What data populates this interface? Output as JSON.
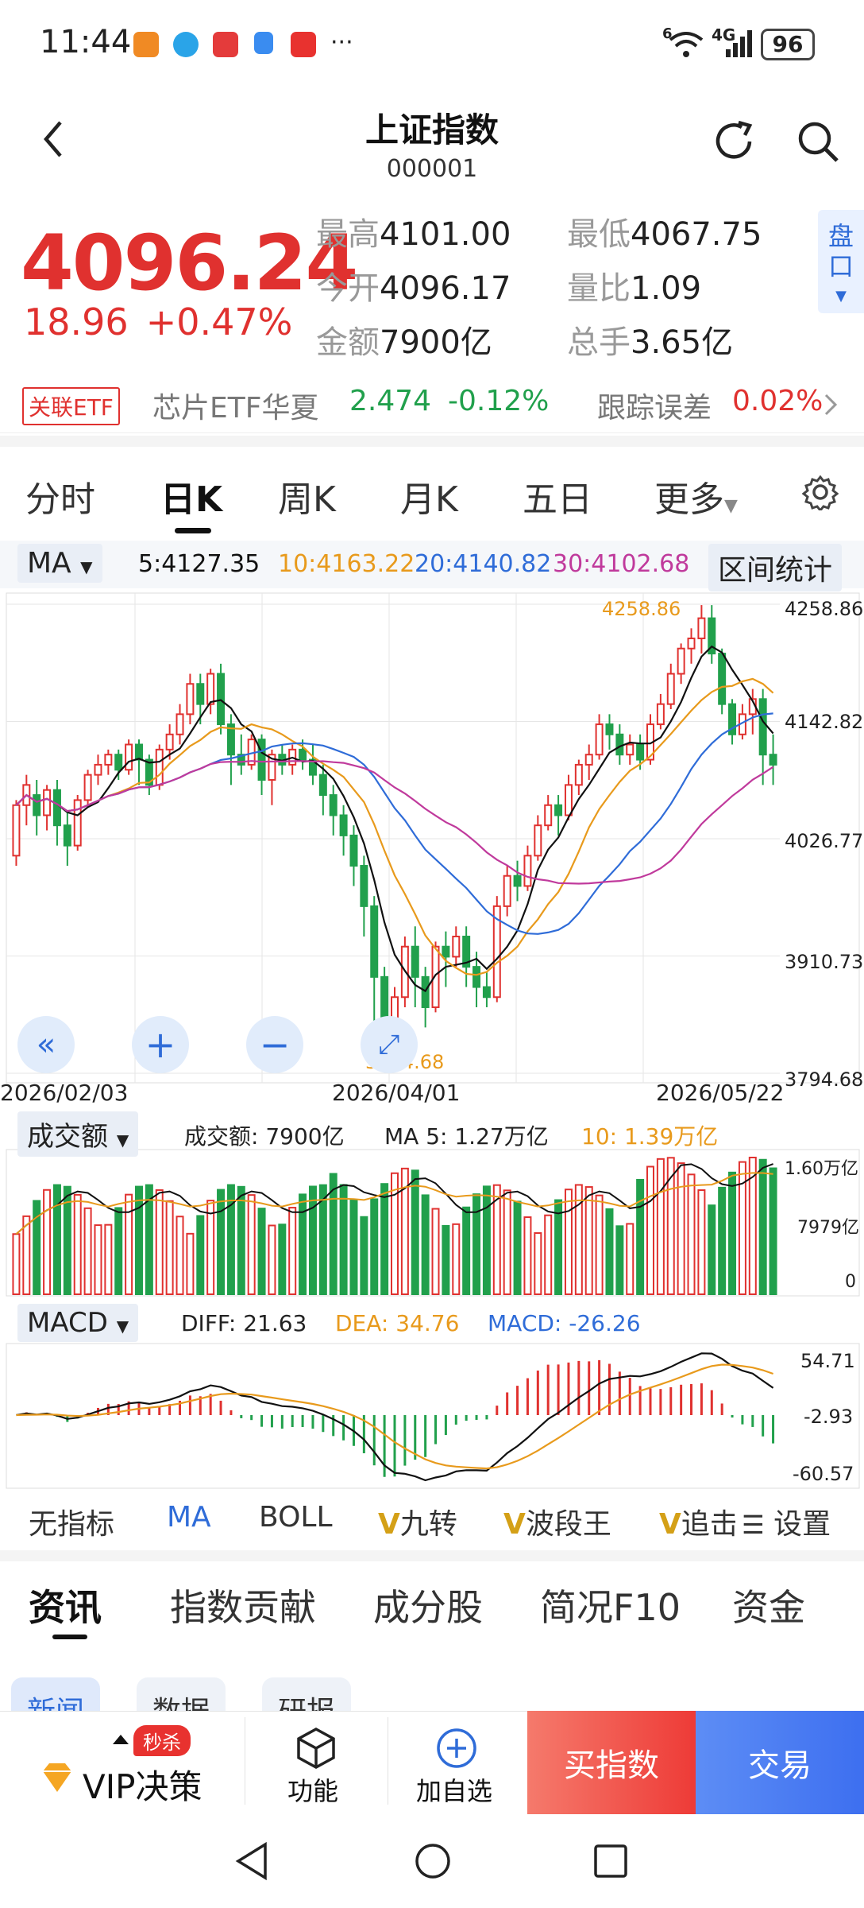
{
  "status_bar": {
    "time": "11:44",
    "network": "4G",
    "battery": "96",
    "more": "···",
    "wifi_sub": "6"
  },
  "header": {
    "title": "上证指数",
    "code": "000001"
  },
  "quote": {
    "price": "4096.24",
    "change": "18.96",
    "change_pct": "+0.47%",
    "high_label": "最高",
    "high": "4101.00",
    "low_label": "最低",
    "low": "4067.75",
    "open_label": "今开",
    "open": "4096.17",
    "vol_ratio_label": "量比",
    "vol_ratio": "1.09",
    "amount_label": "金额",
    "amount": "7900亿",
    "turnover_label": "总手",
    "turnover": "3.65亿",
    "pankou": "盘口"
  },
  "etf": {
    "tag": "关联ETF",
    "name": "芯片ETF华夏",
    "price": "2.474",
    "pct": "-0.12%",
    "err_label": "跟踪误差",
    "err": "0.02%"
  },
  "period_tabs": [
    "分时",
    "日K",
    "周K",
    "月K",
    "五日",
    "更多"
  ],
  "ma_bar": {
    "select": "MA",
    "ma5": "5:4127.35",
    "ma10": "10:4163.22",
    "ma20": "20:4140.82",
    "ma30": "30:4102.68",
    "range_btn": "区间统计"
  },
  "kline": {
    "price_ticks": [
      "4258.86",
      "4142.82",
      "4026.77",
      "3910.73",
      "3794.68"
    ],
    "date_labels": [
      "2026/02/03",
      "2026/04/01",
      "2026/05/22"
    ],
    "max_label": "4258.86",
    "min_label": "3794.68"
  },
  "volume": {
    "select": "成交额",
    "amount_text": "成交额: 7900亿",
    "ma5_text": "MA 5: 1.27万亿",
    "ma10_text": "10: 1.39万亿",
    "ticks": [
      "1.60万亿",
      "7979亿",
      "0"
    ]
  },
  "macd": {
    "select": "MACD",
    "diff": "DIFF: 21.63",
    "dea": "DEA: 34.76",
    "macd": "MACD: -26.26",
    "ticks": [
      "54.71",
      "-2.93",
      "-60.57"
    ]
  },
  "indicator_tabs": [
    "无指标",
    "MA",
    "BOLL",
    "九转",
    "波段王",
    "追击"
  ],
  "indicator_vip_prefix": "V",
  "settings_label": "设置",
  "info_tabs": [
    "资讯",
    "指数贡献",
    "成分股",
    "简况F10",
    "资金"
  ],
  "sub_tabs": [
    "新闻",
    "数据",
    "研报"
  ],
  "footer": {
    "vip": "VIP决策",
    "vip_badge": "秒杀",
    "func": "功能",
    "add": "加自选",
    "buy": "买指数",
    "trade": "交易"
  },
  "colors": {
    "up": "#e0312f",
    "down": "#21a04c",
    "ma5": "#111111",
    "ma10": "#e89a1c",
    "ma20": "#2f6cd8",
    "ma30": "#c03a9c",
    "accent": "#2f6cd8"
  },
  "chart_data": {
    "type": "candlestick",
    "y_range": [
      3794.68,
      4258.86
    ],
    "candles": [
      [
        4010,
        4060,
        4000,
        4065
      ],
      [
        4060,
        4080,
        4040,
        4090
      ],
      [
        4070,
        4050,
        4030,
        4085
      ],
      [
        4050,
        4075,
        4035,
        4080
      ],
      [
        4075,
        4040,
        4020,
        4085
      ],
      [
        4040,
        4020,
        4000,
        4055
      ],
      [
        4020,
        4065,
        4015,
        4070
      ],
      [
        4065,
        4090,
        4060,
        4095
      ],
      [
        4090,
        4100,
        4080,
        4110
      ],
      [
        4100,
        4110,
        4090,
        4115
      ],
      [
        4110,
        4095,
        4085,
        4115
      ],
      [
        4095,
        4120,
        4090,
        4125
      ],
      [
        4120,
        4105,
        4080,
        4125
      ],
      [
        4105,
        4080,
        4070,
        4110
      ],
      [
        4080,
        4115,
        4075,
        4120
      ],
      [
        4115,
        4130,
        4105,
        4140
      ],
      [
        4130,
        4150,
        4120,
        4160
      ],
      [
        4150,
        4180,
        4140,
        4190
      ],
      [
        4180,
        4160,
        4140,
        4190
      ],
      [
        4160,
        4190,
        4150,
        4195
      ],
      [
        4190,
        4140,
        4130,
        4200
      ],
      [
        4140,
        4110,
        4080,
        4150
      ],
      [
        4110,
        4100,
        4090,
        4130
      ],
      [
        4100,
        4125,
        4095,
        4130
      ],
      [
        4125,
        4085,
        4070,
        4130
      ],
      [
        4085,
        4110,
        4060,
        4115
      ],
      [
        4110,
        4100,
        4090,
        4120
      ],
      [
        4100,
        4115,
        4090,
        4120
      ],
      [
        4115,
        4105,
        4095,
        4125
      ],
      [
        4105,
        4090,
        4080,
        4120
      ],
      [
        4090,
        4070,
        4050,
        4100
      ],
      [
        4070,
        4050,
        4030,
        4080
      ],
      [
        4050,
        4030,
        4010,
        4060
      ],
      [
        4030,
        4000,
        3980,
        4040
      ],
      [
        4000,
        3960,
        3930,
        4010
      ],
      [
        3960,
        3890,
        3800,
        3970
      ],
      [
        3890,
        3840,
        3800,
        3900
      ],
      [
        3840,
        3870,
        3810,
        3880
      ],
      [
        3870,
        3920,
        3860,
        3930
      ],
      [
        3920,
        3890,
        3860,
        3940
      ],
      [
        3890,
        3860,
        3840,
        3900
      ],
      [
        3860,
        3920,
        3855,
        3925
      ],
      [
        3920,
        3910,
        3880,
        3935
      ],
      [
        3910,
        3930,
        3900,
        3940
      ],
      [
        3930,
        3900,
        3880,
        3940
      ],
      [
        3900,
        3880,
        3860,
        3915
      ],
      [
        3880,
        3870,
        3860,
        3895
      ],
      [
        3870,
        3960,
        3865,
        3970
      ],
      [
        3960,
        3990,
        3950,
        4000
      ],
      [
        3990,
        3980,
        3965,
        4005
      ],
      [
        3980,
        4010,
        3975,
        4020
      ],
      [
        4010,
        4040,
        4005,
        4050
      ],
      [
        4040,
        4060,
        4035,
        4070
      ],
      [
        4060,
        4050,
        4030,
        4070
      ],
      [
        4050,
        4080,
        4045,
        4090
      ],
      [
        4080,
        4100,
        4070,
        4105
      ],
      [
        4100,
        4110,
        4085,
        4120
      ],
      [
        4110,
        4140,
        4105,
        4150
      ],
      [
        4140,
        4130,
        4115,
        4150
      ],
      [
        4130,
        4110,
        4100,
        4140
      ],
      [
        4110,
        4120,
        4100,
        4130
      ],
      [
        4120,
        4105,
        4095,
        4130
      ],
      [
        4105,
        4140,
        4100,
        4150
      ],
      [
        4140,
        4160,
        4135,
        4170
      ],
      [
        4160,
        4190,
        4155,
        4200
      ],
      [
        4190,
        4215,
        4180,
        4220
      ],
      [
        4215,
        4225,
        4200,
        4235
      ],
      [
        4225,
        4245,
        4210,
        4258
      ],
      [
        4245,
        4210,
        4200,
        4258
      ],
      [
        4210,
        4160,
        4150,
        4215
      ],
      [
        4160,
        4130,
        4120,
        4165
      ],
      [
        4130,
        4150,
        4125,
        4160
      ],
      [
        4150,
        4165,
        4130,
        4175
      ],
      [
        4165,
        4110,
        4080,
        4175
      ],
      [
        4110,
        4100,
        4080,
        4130
      ]
    ]
  }
}
